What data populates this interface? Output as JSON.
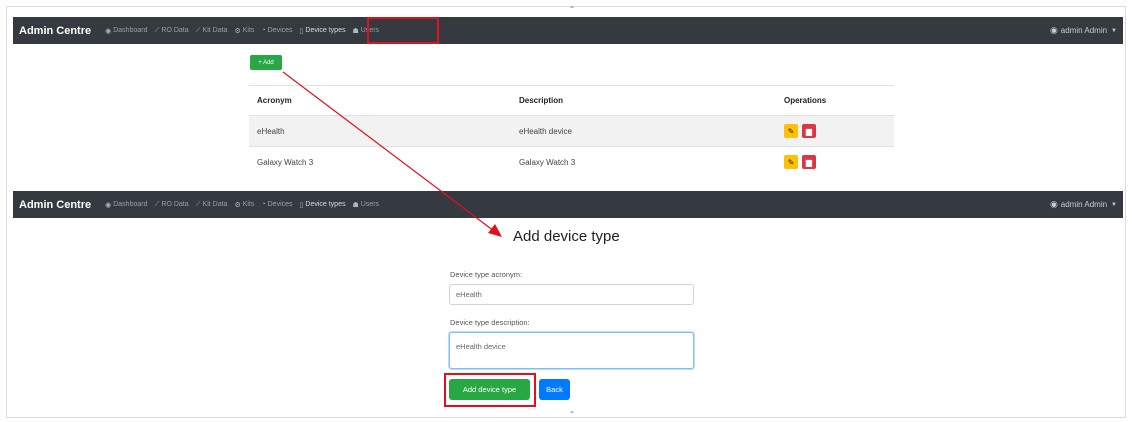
{
  "nav": {
    "brand": "Admin Centre",
    "items": [
      {
        "icon": "dashboard-icon",
        "glyph": "◉",
        "label": "Dashboard"
      },
      {
        "icon": "chart-line-icon",
        "glyph": "⟋",
        "label": "RO Data"
      },
      {
        "icon": "chart-line-icon",
        "glyph": "⟋",
        "label": "Kit Data"
      },
      {
        "icon": "cogs-icon",
        "glyph": "⚙",
        "label": "Kits"
      },
      {
        "icon": "rss-icon",
        "glyph": "◔",
        "label": "Devices"
      },
      {
        "icon": "mobile-icon",
        "glyph": "▯",
        "label": "Device types"
      },
      {
        "icon": "users-icon",
        "glyph": "☗",
        "label": "Users"
      }
    ],
    "user": "admin Admin"
  },
  "list_page": {
    "add_label": "+ Add",
    "columns": [
      "Acronym",
      "Description",
      "Operations"
    ],
    "rows": [
      {
        "acronym": "eHealth",
        "description": "eHealth device"
      },
      {
        "acronym": "Galaxy Watch 3",
        "description": "Galaxy Watch 3"
      }
    ]
  },
  "form_page": {
    "title": "Add device type",
    "acronym_label": "Device type acronym:",
    "acronym_value": "eHealth",
    "description_label": "Device type description:",
    "description_value": "eHealth device",
    "submit_label": "Add device type",
    "back_label": "Back"
  },
  "colors": {
    "navbar": "#343a40",
    "success": "#28a745",
    "primary": "#007bff",
    "warning": "#ffc107",
    "danger": "#dc3545",
    "annotation": "#e0101e"
  }
}
